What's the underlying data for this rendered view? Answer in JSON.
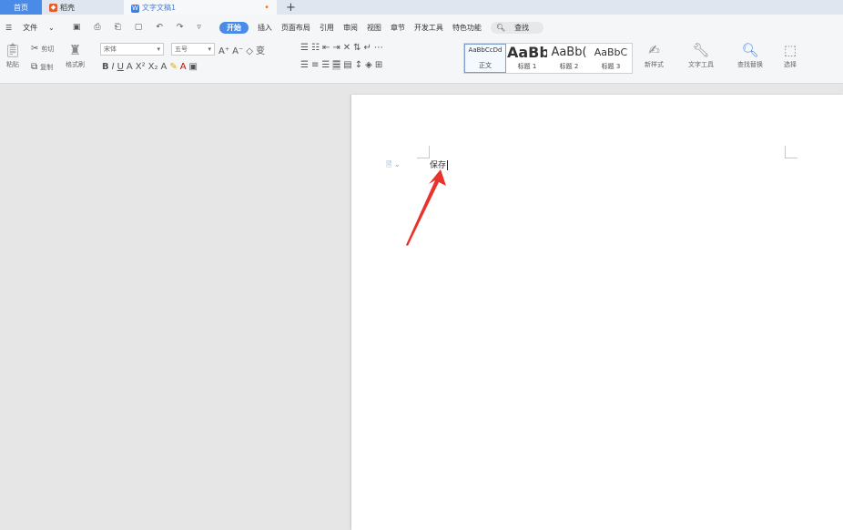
{
  "tabs": {
    "home": "首页",
    "daoke": "稻壳",
    "doc": "文字文稿1",
    "new_tab": "+"
  },
  "menu": {
    "file": "文件",
    "items": [
      "开始",
      "插入",
      "页面布局",
      "引用",
      "审阅",
      "视图",
      "章节",
      "开发工具",
      "特色功能"
    ],
    "search": "查找"
  },
  "ribbon": {
    "paste": "粘贴",
    "cut": "剪切",
    "copy": "复制",
    "format_painter": "格式刷",
    "font_name": "宋体",
    "font_size": "五号",
    "styles": [
      {
        "sample": "AaBbCcDd",
        "name": "正文"
      },
      {
        "sample": "AaBb",
        "name": "标题 1"
      },
      {
        "sample": "AaBb(",
        "name": "标题 2"
      },
      {
        "sample": "AaBbC",
        "name": "标题 3"
      }
    ],
    "new_style": "新样式",
    "text_tools": "文字工具",
    "find_replace": "查找替换",
    "select": "选择"
  },
  "document": {
    "text": "保存"
  },
  "colors": {
    "accent": "#4a8be8",
    "arrow": "#e8322c"
  }
}
